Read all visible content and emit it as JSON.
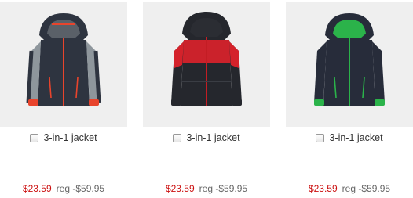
{
  "products": [
    {
      "name": "3-in-1 jacket",
      "sale_price": "$23.59",
      "reg_label": "reg - ",
      "reg_price": "$59.95",
      "colors": {
        "body": "#2e3440",
        "panel": "#8e969c",
        "trim": "#e8442c",
        "zipper": "#e8442c",
        "hood_lining": "#5a6068"
      }
    },
    {
      "name": "3-in-1 jacket",
      "sale_price": "$23.59",
      "reg_label": "reg - ",
      "reg_price": "$59.95",
      "colors": {
        "body": "#25272d",
        "panel": "#d4222b",
        "trim": "#d4222b",
        "zipper": "#c31d24",
        "hood_lining": "#2b2d33"
      }
    },
    {
      "name": "3-in-1 jacket",
      "sale_price": "$23.59",
      "reg_label": "reg - ",
      "reg_price": "$59.95",
      "colors": {
        "body": "#272c3a",
        "panel": "#272c3a",
        "trim": "#2bb34a",
        "zipper": "#2bb34a",
        "hood_lining": "#2bb34a"
      }
    }
  ]
}
